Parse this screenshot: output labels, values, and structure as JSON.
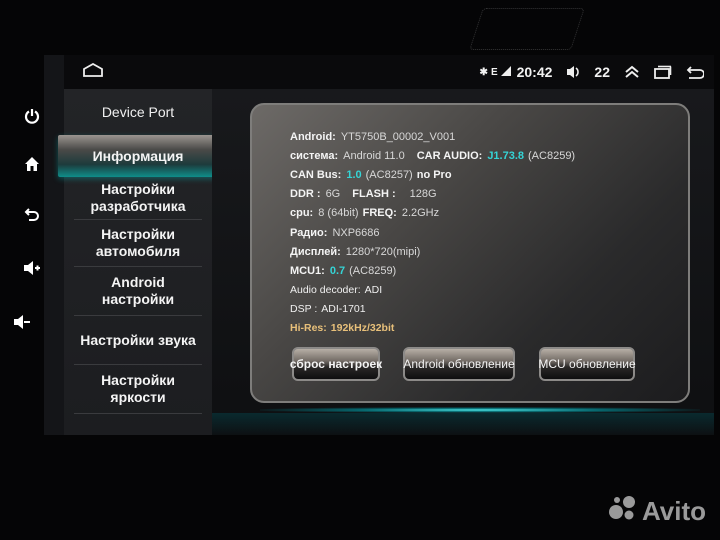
{
  "status_bar": {
    "time": "20:42",
    "volume": "22",
    "icons": [
      "home-icon",
      "bluetooth-icon",
      "signal-e-icon",
      "signal-bars-icon",
      "volume-icon",
      "expand-up-icon",
      "recent-apps-icon",
      "back-icon"
    ]
  },
  "side_keys": [
    "power-icon",
    "home-icon",
    "back-icon",
    "volume-up-icon",
    "volume-down-icon"
  ],
  "sidebar": {
    "title": "Device Port",
    "items": [
      {
        "label": "Информация",
        "active": true
      },
      {
        "label": "Настройки разработчика",
        "active": false
      },
      {
        "label": "Настройки автомобиля",
        "active": false
      },
      {
        "label": "Android настройки",
        "active": false
      },
      {
        "label": "Настройки звука",
        "active": false
      },
      {
        "label": "Настройки яркости",
        "active": false
      }
    ]
  },
  "info": {
    "android_label": "Android:",
    "android_value": "YT5750B_00002_V001",
    "system_label": "система:",
    "system_value": "Android 11.0",
    "car_audio_label": "CAR AUDIO:",
    "car_audio_value": "J1.73.8",
    "car_audio_chip": "(AC8259)",
    "can_label": "CAN Bus:",
    "can_value": "1.0",
    "can_chip": "(AC8257)",
    "can_extra": "no Pro",
    "ddr_label": "DDR :",
    "ddr_value": "6G",
    "flash_label": "FLASH :",
    "flash_value": "128G",
    "cpu_label": "cpu:",
    "cpu_value": "8 (64bit)",
    "freq_label": "FREQ:",
    "freq_value": "2.2GHz",
    "radio_label": "Радио:",
    "radio_value": "NXP6686",
    "display_label": "Дисплей:",
    "display_value": "1280*720(mipi)",
    "mcu_label": "MCU1:",
    "mcu_value": "0.7",
    "mcu_chip": "(AC8259)",
    "decoder_label": "Audio decoder:",
    "decoder_value": "ADI",
    "dsp_label": "DSP :",
    "dsp_value": "ADI-1701",
    "hires_label": "Hi-Res:",
    "hires_value": "192kHz/32bit"
  },
  "buttons": {
    "reset": "сброс настроек",
    "android_update": "Android обновление",
    "mcu_update": "MCU обновление"
  },
  "watermark": "Avito",
  "colors": {
    "accent_cyan": "#35d4d6",
    "hires_gold": "#e8c07a"
  }
}
